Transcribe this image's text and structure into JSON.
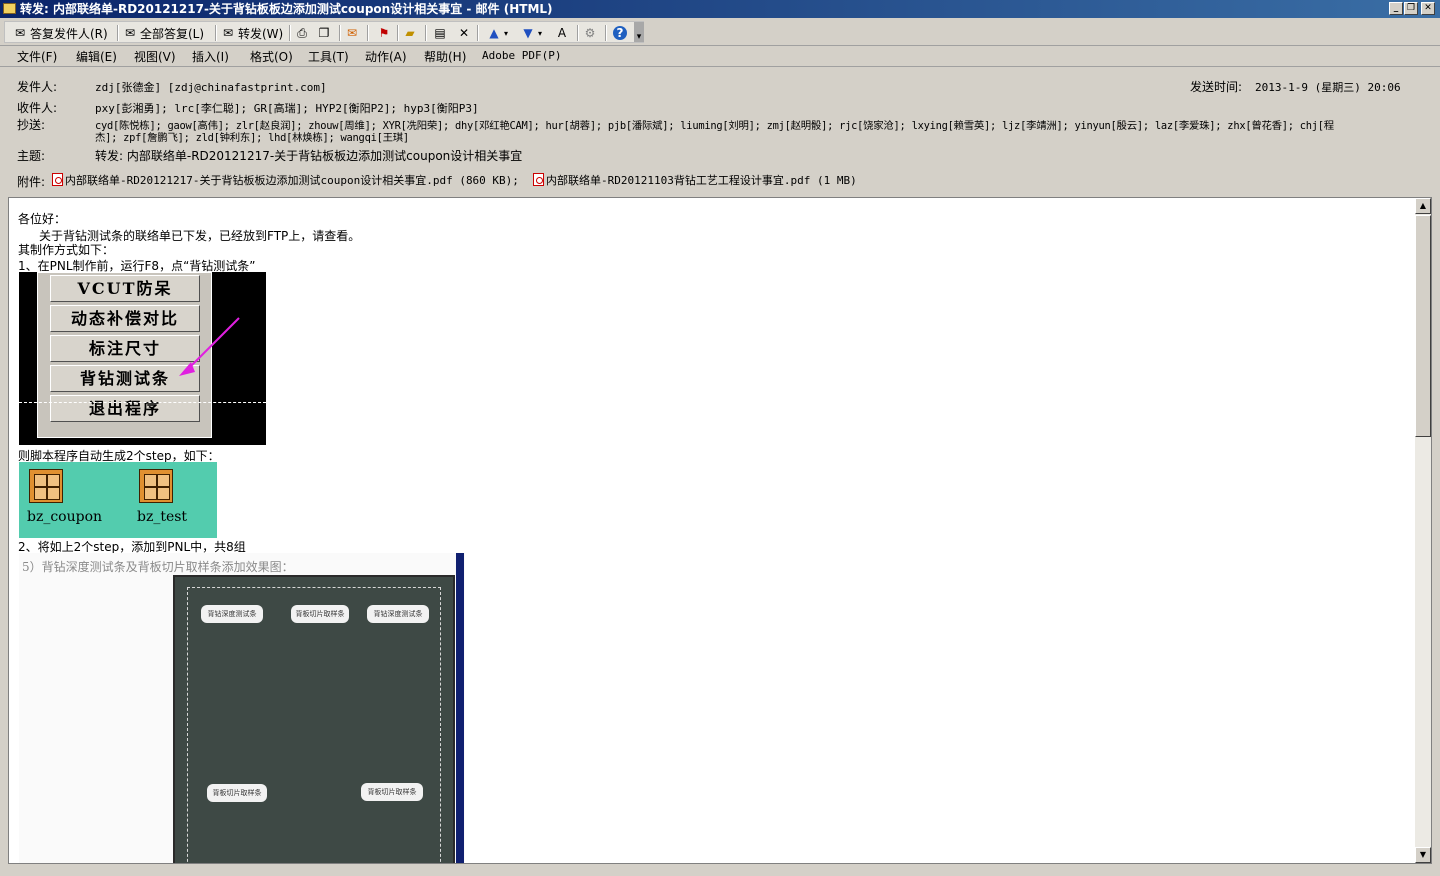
{
  "window": {
    "title": "转发: 内部联络单-RD20121217-关于背钻板板边添加测试coupon设计相关事宜 - 邮件 (HTML)",
    "minimize": "_",
    "restore": "❐",
    "close": "✕"
  },
  "toolbar": {
    "reply_sender": "答复发件人(R)",
    "reply_all": "全部答复(L)",
    "forward": "转发(W)",
    "more": "▾"
  },
  "menubar": {
    "items": [
      "文件(F)",
      "编辑(E)",
      "视图(V)",
      "插入(I)",
      "格式(O)",
      "工具(T)",
      "动作(A)",
      "帮助(H)",
      "Adobe PDF(P)"
    ]
  },
  "header": {
    "from_label": "发件人:",
    "from_value": "zdj[张德金] [zdj@chinafastprint.com]",
    "sent_label": "发送时间:",
    "sent_value": "2013-1-9 (星期三) 20:06",
    "to_label": "收件人:",
    "to_value": "pxy[彭湘勇]; lrc[李仁聪]; GR[高瑞]; HYP2[衡阳P2]; hyp3[衡阳P3]",
    "cc_label": "抄送:",
    "cc_value_line1": "cyd[陈悦栋]; gaow[高伟]; zlr[赵良润]; zhouw[周维]; XYR[冼阳荣]; dhy[邓红艳CAM]; hur[胡蓉]; pjb[潘际斌]; liuming[刘明]; zmj[赵明骰]; rjc[饶家沧]; lxying[赖雪英]; ljz[李靖洲]; yinyun[殷云]; laz[李爱珠]; zhx[曾花香]; chj[程",
    "cc_value_line2": "杰]; zpf[詹鹏飞]; zld[钟利东]; lhd[林焕栋]; wangqi[王琪]",
    "subject_label": "主题:",
    "subject_value": "转发: 内部联络单-RD20121217-关于背钻板板边添加测试coupon设计相关事宜",
    "attach_label": "附件:",
    "attachments": [
      "内部联络单-RD20121217-关于背钻板板边添加测试coupon设计相关事宜.pdf (860 KB);",
      "内部联络单-RD20121103背钻工艺工程设计事宜.pdf (1 MB)"
    ]
  },
  "body": {
    "greeting": "各位好：",
    "line1": "关于背钻测试条的联络单已下发，已经放到FTP上，请查看。",
    "line2": "其制作方式如下：",
    "line3": "1、在PNL制作前，运行F8，点“背钻测试条”",
    "menu_buttons": [
      "VCUT防呆",
      "动态补偿对比",
      "标注尺寸",
      "背钻测试条",
      "退出程序"
    ],
    "line4": "则脚本程序自动生成2个step，如下：",
    "steps": [
      "bz_coupon",
      "bz_test"
    ],
    "line5": "2、将如上2个step，添加到PNL中，共8组",
    "pic3_caption": "5）背钻深度测试条及背板切片取样条添加效果图：",
    "pic3_bubbles": [
      "背钻深度测试条",
      "背板切片取样条",
      "背钻深度测试条",
      "背板切片取样条",
      "背板切片取样条"
    ]
  },
  "colors": {
    "titlebar": "#0a246a",
    "step_bg": "#53ccae",
    "arrow": "#e020e0"
  }
}
